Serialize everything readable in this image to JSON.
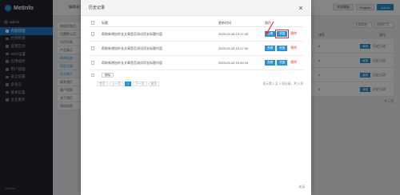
{
  "app": {
    "logo": "MetInfo",
    "user": "admin"
  },
  "sidebar": {
    "items": [
      {
        "label": "内容管理",
        "active": true
      },
      {
        "label": "栏目管理"
      },
      {
        "label": "反馈互动"
      },
      {
        "label": "SEO设置"
      },
      {
        "label": "应用插件"
      },
      {
        "label": "用户管理"
      },
      {
        "label": "安全设置"
      },
      {
        "label": "多语言"
      },
      {
        "label": "基本设置"
      },
      {
        "label": "企业服务"
      }
    ],
    "footer": "MetInfo"
  },
  "topbar": {
    "title": "编辑长文",
    "buttons": [
      "本地模板",
      "English",
      "admin"
    ]
  },
  "left_col": {
    "items": [
      "按钮状态页",
      "设置默认页",
      "内页列表",
      "产品展示",
      "新闻动态",
      "历史记录",
      "企业简介",
      "联系我们",
      "客户案例",
      "关于我们",
      "网站地图"
    ]
  },
  "right_area": {
    "filters": [
      "全部状态",
      "选择栏目"
    ],
    "header": [
      "排序",
      "操作"
    ],
    "rows": [
      {
        "num": "0",
        "op": "编辑",
        "link": "历史记录"
      },
      {
        "num": "0",
        "op": "编辑",
        "link": "历史记录"
      },
      {
        "num": "0",
        "op": "编辑",
        "link": "历史记录"
      },
      {
        "num": "0",
        "op": "编辑",
        "link": "历史记录"
      }
    ],
    "pager": "共 1 页"
  },
  "modal": {
    "title": "历史记录",
    "close_glyph": "×",
    "columns": {
      "title": "标题",
      "time": "更新时间",
      "ops": "操作"
    },
    "rows": [
      {
        "title": "帮助新增加的长文章是否测试用长标题内容",
        "time": "2023-03-28 15:17:42",
        "view": "查看",
        "restore": "恢复",
        "delete": "删除"
      },
      {
        "title": "帮助新增加的长文章是否测试用长标题内容",
        "time": "2023-03-28 15:17:33",
        "view": "查看",
        "restore": "恢复",
        "delete": "删除"
      },
      {
        "title": "帮助新增加的长文章是否测试用长标题内容",
        "time": "2023-03-28 15:49:16",
        "view": "查看",
        "restore": "恢复",
        "delete": "删除"
      }
    ],
    "bulk_delete": "删除",
    "pagination": {
      "first": "首页",
      "prev": "上一页",
      "current": "1",
      "next": "下一页",
      "last": "尾页",
      "info": "显示第 1 至 3 项记录，共 3 项"
    },
    "footer": "关闭"
  },
  "colors": {
    "accent": "#2a92d4",
    "sidebar_bg": "#22262e",
    "danger": "#e03434"
  }
}
